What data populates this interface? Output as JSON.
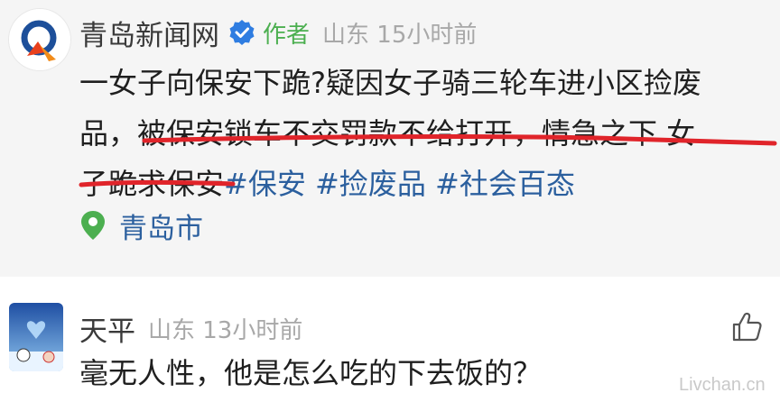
{
  "post": {
    "author_name": "青岛新闻网",
    "author_tag": "作者",
    "location_time": "山东 15小时前",
    "body_lines": [
      "一女子向保安下跪?疑因女子骑三轮车进小区捡废",
      "品，被保安锁车不交罚款不给打开，情急之下 女",
      "子跪求保安"
    ],
    "hashtags": [
      "#保安",
      "#捡废品",
      "#社会百态"
    ],
    "location": "青岛市",
    "colors": {
      "accent_green": "#4caf50",
      "link_blue": "#2b5f9e",
      "underline_red": "#e0242a"
    }
  },
  "comment": {
    "author_name": "天平",
    "meta": "山东 13小时前",
    "text": "毫无人性，他是怎么吃的下去饭的？"
  },
  "watermark": "Livchan.cn"
}
